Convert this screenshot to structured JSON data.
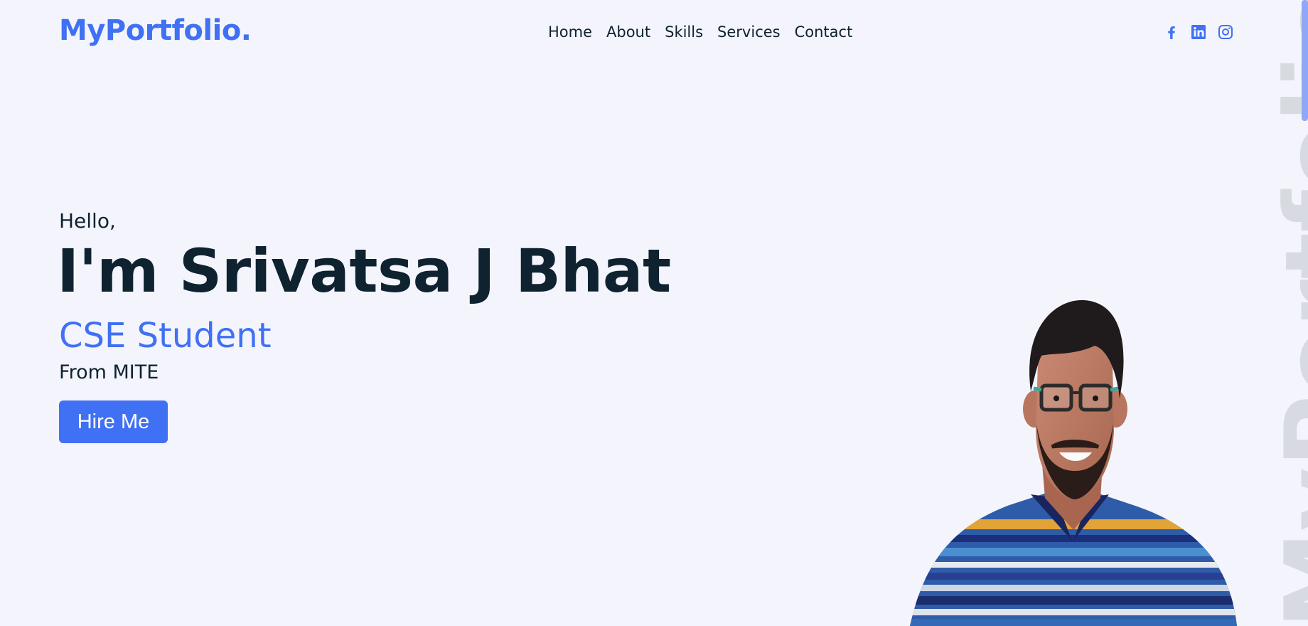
{
  "header": {
    "logo": "MyPortfolio.",
    "nav": [
      "Home",
      "About",
      "Skills",
      "Services",
      "Contact"
    ],
    "socials": [
      "facebook-icon",
      "linkedin-icon",
      "instagram-icon"
    ]
  },
  "hero": {
    "greeting": "Hello,",
    "name": "I'm Srivatsa J Bhat",
    "role": "CSE Student",
    "from": "From MITE",
    "cta": "Hire Me"
  },
  "watermark": "MyPortfolio.",
  "colors": {
    "accent": "#4070f4",
    "text": "#0f2230",
    "background": "#f4f5fc",
    "watermark": "#d7dbe1"
  }
}
